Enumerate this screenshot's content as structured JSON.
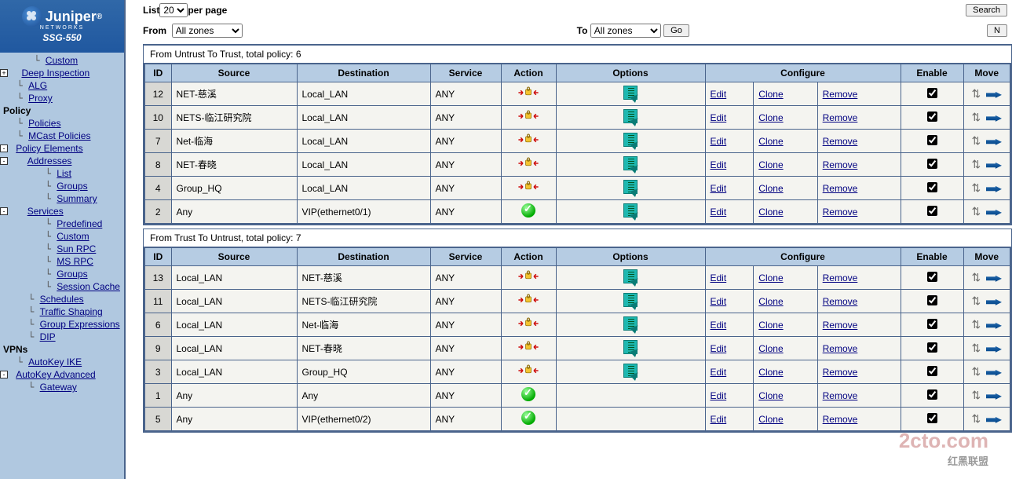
{
  "branding": {
    "name": "Juniper",
    "sub": "NETWORKS",
    "device": "SSG-550"
  },
  "nav": {
    "custom": "Custom",
    "deep_inspection": "Deep Inspection",
    "alg": "ALG",
    "proxy": "Proxy",
    "policy_header": "Policy",
    "policies": "Policies",
    "mcast_policies": "MCast Policies",
    "policy_elements": "Policy Elements",
    "addresses": "Addresses",
    "list": "List",
    "groups": "Groups",
    "summary": "Summary",
    "services": "Services",
    "predefined": "Predefined",
    "custom2": "Custom",
    "sunrpc": "Sun RPC",
    "msrpc": "MS RPC",
    "groups2": "Groups",
    "session_cache": "Session Cache",
    "schedules": "Schedules",
    "traffic_shaping": "Traffic Shaping",
    "group_expressions": "Group Expressions",
    "dip": "DIP",
    "vpns_header": "VPNs",
    "autokey_ike": "AutoKey IKE",
    "autokey_advanced": "AutoKey Advanced",
    "gateway": "Gateway"
  },
  "toolbar": {
    "list_label": "List",
    "per_page_label": "per page",
    "per_page_value": "20",
    "from_label": "From",
    "from_value": "All zones",
    "to_label": "To",
    "to_value": "All zones",
    "go": "Go",
    "search": "Search"
  },
  "columns": {
    "id": "ID",
    "source": "Source",
    "destination": "Destination",
    "service": "Service",
    "action": "Action",
    "options": "Options",
    "configure": "Configure",
    "enable": "Enable",
    "move": "Move"
  },
  "configure_labels": {
    "edit": "Edit",
    "clone": "Clone",
    "remove": "Remove"
  },
  "sections": [
    {
      "title": "From Untrust To Trust, total policy: 6",
      "rows": [
        {
          "id": "12",
          "source": "NET-慈溪",
          "destination": "Local_LAN",
          "service": "ANY",
          "action": "permit-vpn",
          "options": true,
          "enable": true
        },
        {
          "id": "10",
          "source": "NETS-临江研究院",
          "destination": "Local_LAN",
          "service": "ANY",
          "action": "permit-vpn",
          "options": true,
          "enable": true
        },
        {
          "id": "7",
          "source": "Net-临海",
          "destination": "Local_LAN",
          "service": "ANY",
          "action": "permit-vpn",
          "options": true,
          "enable": true
        },
        {
          "id": "8",
          "source": "NET-春晓",
          "destination": "Local_LAN",
          "service": "ANY",
          "action": "permit-vpn",
          "options": true,
          "enable": true
        },
        {
          "id": "4",
          "source": "Group_HQ",
          "destination": "Local_LAN",
          "service": "ANY",
          "action": "permit-vpn",
          "options": true,
          "enable": true
        },
        {
          "id": "2",
          "source": "Any",
          "destination": "VIP(ethernet0/1)",
          "service": "ANY",
          "action": "permit",
          "options": true,
          "enable": true
        }
      ]
    },
    {
      "title": "From Trust To Untrust, total policy: 7",
      "rows": [
        {
          "id": "13",
          "source": "Local_LAN",
          "destination": "NET-慈溪",
          "service": "ANY",
          "action": "permit-vpn",
          "options": true,
          "enable": true
        },
        {
          "id": "11",
          "source": "Local_LAN",
          "destination": "NETS-临江研究院",
          "service": "ANY",
          "action": "permit-vpn",
          "options": true,
          "enable": true
        },
        {
          "id": "6",
          "source": "Local_LAN",
          "destination": "Net-临海",
          "service": "ANY",
          "action": "permit-vpn",
          "options": true,
          "enable": true
        },
        {
          "id": "9",
          "source": "Local_LAN",
          "destination": "NET-春晓",
          "service": "ANY",
          "action": "permit-vpn",
          "options": true,
          "enable": true
        },
        {
          "id": "3",
          "source": "Local_LAN",
          "destination": "Group_HQ",
          "service": "ANY",
          "action": "permit-vpn",
          "options": true,
          "enable": true
        },
        {
          "id": "1",
          "source": "Any",
          "destination": "Any",
          "service": "ANY",
          "action": "permit",
          "options": false,
          "enable": true
        },
        {
          "id": "5",
          "source": "Any",
          "destination": "VIP(ethernet0/2)",
          "service": "ANY",
          "action": "permit",
          "options": false,
          "enable": true
        }
      ]
    }
  ]
}
